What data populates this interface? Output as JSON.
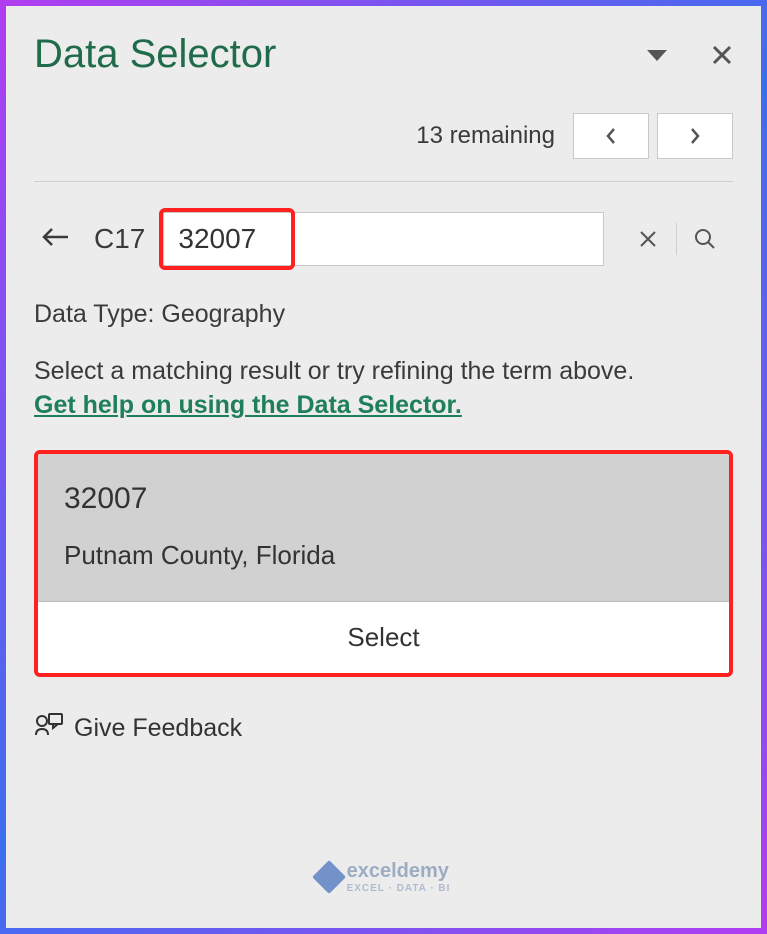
{
  "header": {
    "title": "Data Selector"
  },
  "remaining": {
    "text": "13 remaining"
  },
  "search": {
    "cell_ref": "C17",
    "value": "32007"
  },
  "data_type_label": "Data Type: Geography",
  "instruction": "Select a matching result or try refining the term above.",
  "help_link": "Get help on using the Data Selector.",
  "result": {
    "title": "32007",
    "subtitle": "Putnam County, Florida",
    "select_label": "Select"
  },
  "feedback_label": "Give Feedback",
  "watermark": {
    "brand": "exceldemy",
    "tag": "EXCEL · DATA · BI"
  },
  "nav": {
    "prev": "‹",
    "next": "›"
  }
}
